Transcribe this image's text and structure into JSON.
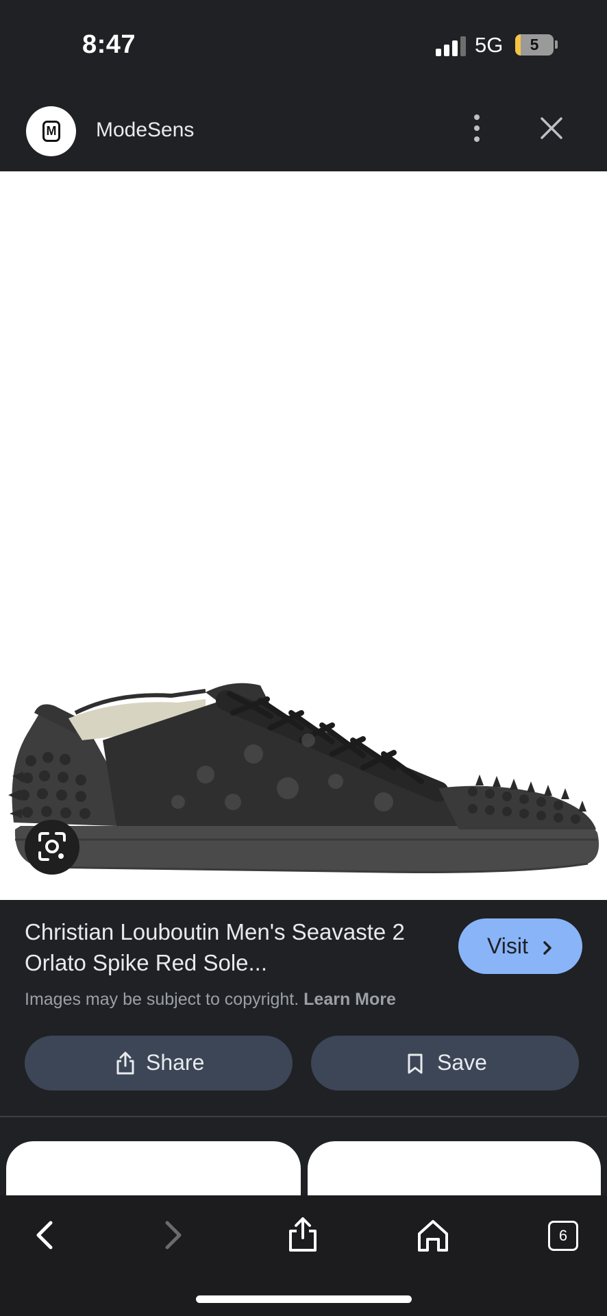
{
  "status_bar": {
    "time": "8:47",
    "network": "5G",
    "battery_level": "5",
    "icons": [
      "signal-icon",
      "battery-icon"
    ]
  },
  "header": {
    "site_logo_letter": "M",
    "site_name": "ModeSens",
    "icons": [
      "more-vert-icon",
      "close-icon"
    ]
  },
  "image": {
    "description_icon": "google-lens-icon"
  },
  "product": {
    "title": "Christian Louboutin Men's Seavaste 2 Orlato Spike Red Sole...",
    "visit_label": "Visit",
    "copyright_text": "Images may be subject to copyright.",
    "learn_more_label": "Learn More",
    "share_label": "Share",
    "save_label": "Save"
  },
  "toolbar": {
    "tabs_count": "6",
    "icons": [
      "back-icon",
      "forward-icon",
      "share-icon",
      "home-icon",
      "tabs-icon"
    ]
  },
  "colors": {
    "background": "#202124",
    "visit_button": "#8ab4f8",
    "pill_button": "#3c4657",
    "toolbar": "#1c1c1e"
  }
}
